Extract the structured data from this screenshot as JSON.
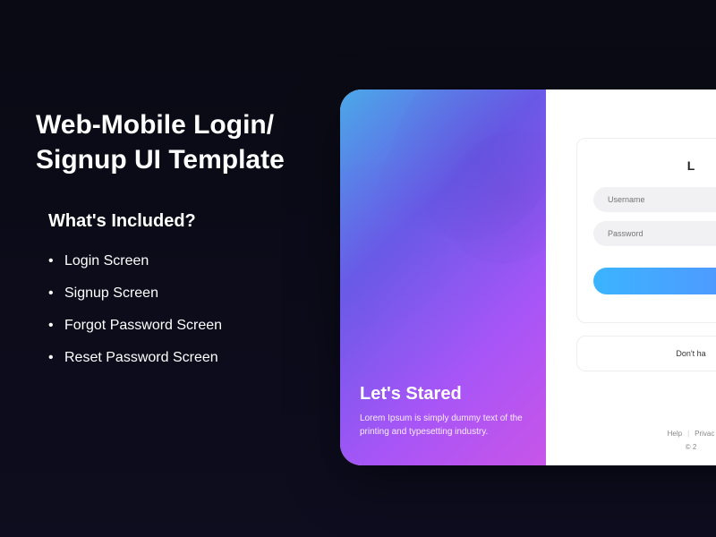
{
  "promo": {
    "title": "Web-Mobile Login/ Signup UI Template",
    "subtitle": "What's Included?",
    "items": [
      "Login Screen",
      "Signup Screen",
      "Forgot Password Screen",
      "Reset Password Screen"
    ]
  },
  "hero": {
    "title": "Let's Stared",
    "description": "Lorem Ipsum is simply dummy text of the printing and typesetting industry."
  },
  "form": {
    "title_partial": "L",
    "username_placeholder": "Username",
    "password_placeholder": "Password",
    "signup_prompt_partial": "Don't ha"
  },
  "footer": {
    "help": "Help",
    "privacy_partial": "Privac",
    "copyright_partial": "© 2"
  }
}
